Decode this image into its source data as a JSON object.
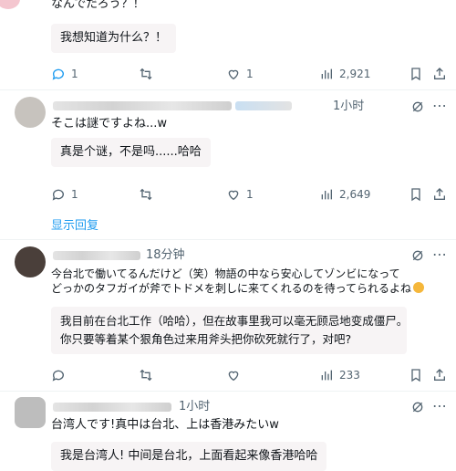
{
  "thread": [
    {
      "id": "post1",
      "original_text": "なんでだろう？！",
      "translation": "我想知道为什么？！",
      "actions": {
        "replies": "1",
        "retweets": "",
        "likes": "1",
        "views": "2,921"
      }
    },
    {
      "id": "post2",
      "time": "1小时",
      "original_text": "そこは謎ですよね...w",
      "translation": "真是个谜，不是吗......哈哈",
      "actions": {
        "replies": "1",
        "retweets": "",
        "likes": "1",
        "views": "2,649"
      }
    },
    {
      "id": "show_replies",
      "label": "显示回复"
    },
    {
      "id": "post3",
      "time": "18分钟",
      "original_line1": "今台北で働いてるんだけど（笑）物語の中なら安心してゾンビになって",
      "original_line2": "どっかのタフガイが斧でトドメを刺しに来てくれるのを待ってられるよね",
      "translation_line1": "我目前在台北工作（哈哈），但在故事里我可以毫无顾忌地变成僵尸。",
      "translation_line2": "你只要等着某个狠角色过来用斧头把你砍死就行了，对吧?",
      "actions": {
        "replies": "",
        "retweets": "",
        "likes": "",
        "views": "233"
      }
    },
    {
      "id": "post4",
      "time": "1小时",
      "original_text": "台湾人です!真中は台北、上は香港みたいw",
      "translation": "我是台湾人! 中间是台北，上面看起来像香港哈哈"
    }
  ],
  "colors": {
    "link": "#1d9bf0",
    "muted": "#536471",
    "box": "#f7f4f5"
  },
  "icons": [
    "reply-icon",
    "retweet-icon",
    "like-icon",
    "views-icon",
    "bookmark-icon",
    "share-icon",
    "grok-icon",
    "more-icon",
    "emoji-face-icon"
  ]
}
